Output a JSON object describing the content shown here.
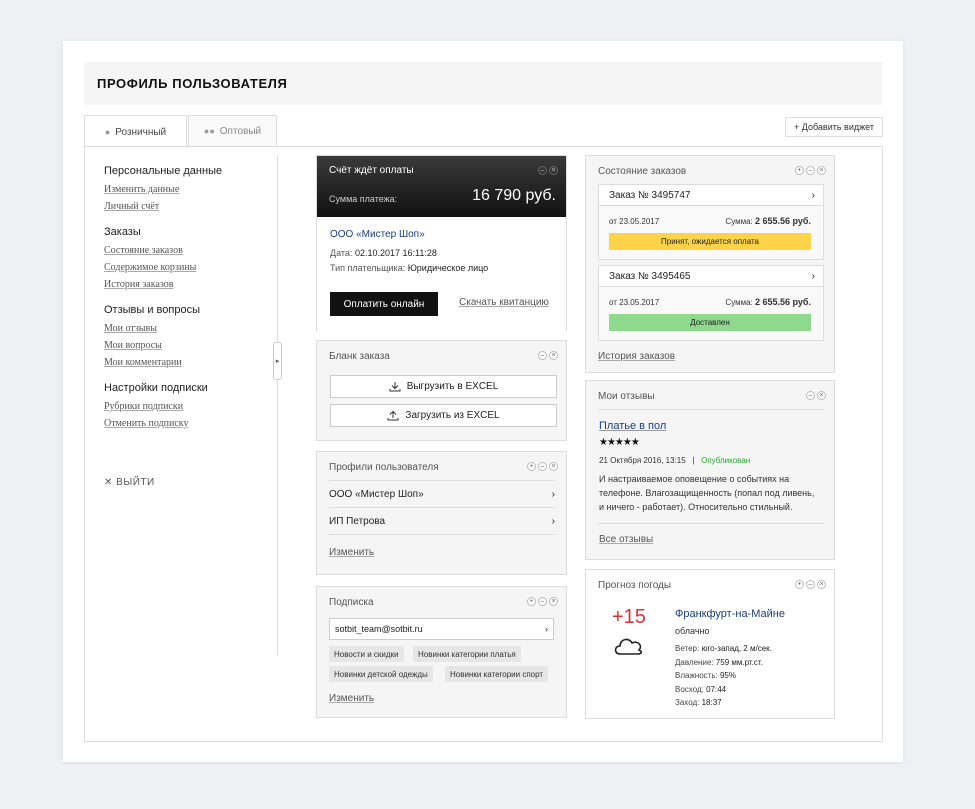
{
  "page_title": "ПРОФИЛЬ ПОЛЬЗОВАТЕЛЯ",
  "tabs": [
    {
      "label": "Розничный",
      "icon": "user-icon"
    },
    {
      "label": "Оптовый",
      "icon": "users-icon"
    }
  ],
  "add_widget": "+ Добавить виджет",
  "sidebar": {
    "groups": [
      {
        "title": "Персональные данные",
        "links": [
          "Изменить данные",
          "Личный счёт"
        ]
      },
      {
        "title": "Заказы",
        "links": [
          "Состояние заказов",
          "Содержимое корзины",
          "История заказов"
        ]
      },
      {
        "title": "Отзывы и вопросы",
        "links": [
          "Мои отзывы",
          "Мои вопросы",
          "Мои комментарии"
        ]
      },
      {
        "title": "Настройки подписки",
        "links": [
          "Рубрики подписки",
          "Отменить подписку"
        ]
      }
    ],
    "logout": "ВЫЙТИ"
  },
  "payment": {
    "title": "Счёт ждёт оплаты",
    "sum_label": "Сумма платежа:",
    "sum_value": "16 790 руб.",
    "company": "ООО «Мистер Шоп»",
    "date_label": "Дата:",
    "date_value": "02.10.2017 16:11:28",
    "payer_label": "Тип плательщика:",
    "payer_value": "Юридическое лицо",
    "pay_button": "Оплатить онлайн",
    "receipt_link": "Скачать квитанцию"
  },
  "order_form": {
    "title": "Бланк заказа",
    "export": "Выгрузить в EXCEL",
    "import": "Загрузить из EXCEL"
  },
  "profiles": {
    "title": "Профили пользователя",
    "items": [
      "ООО «Мистер Шоп»",
      "ИП Петрова"
    ],
    "edit": "Изменить"
  },
  "subscription": {
    "title": "Подписка",
    "email": "sotbit_team@sotbit.ru",
    "chips": [
      "Новости и скидки",
      "Новинки категории платья",
      "Новинки детской одежды",
      "Новинки категории спорт"
    ],
    "edit": "Изменить"
  },
  "orders_status": {
    "title": "Состояние заказов",
    "orders": [
      {
        "number": "Заказ № 3495747",
        "date": "от 23.05.2017",
        "sum_label": "Сумма:",
        "sum_value": "2 655.56 руб.",
        "status": "Принят, ожидается оплата",
        "status_color": "#fdd34a"
      },
      {
        "number": "Заказ № 3495465",
        "date": "от 23.05.2017",
        "sum_label": "Сумма:",
        "sum_value": "2 655.56 руб.",
        "status": "Доставлен",
        "status_color": "#8ed98e"
      }
    ],
    "history": "История заказов"
  },
  "reviews": {
    "title": "Мои отзывы",
    "item_title": "Платье в пол",
    "rating": 5,
    "date": "21 Октября 2016, 13:15",
    "separator": "|",
    "status": "Опубликован",
    "text": "И настраиваемое оповещение о событиях на телефоне. Влагозащищенность (попал под ливень, и ничего - работает). Относительно стильный.",
    "all": "Все отзывы"
  },
  "weather": {
    "title": "Прогноз погоды",
    "temp": "+15",
    "city": "Франкфурт-на-Майне",
    "condition": "облачно",
    "details": [
      {
        "label": "Ветер:",
        "value": "юго-запад, 2 м/сек."
      },
      {
        "label": "Давление:",
        "value": "759 мм.рт.ст."
      },
      {
        "label": "Влажность:",
        "value": "95%"
      },
      {
        "label": "Восход:",
        "value": "07:44"
      },
      {
        "label": "Заход:",
        "value": "18:37"
      }
    ]
  }
}
